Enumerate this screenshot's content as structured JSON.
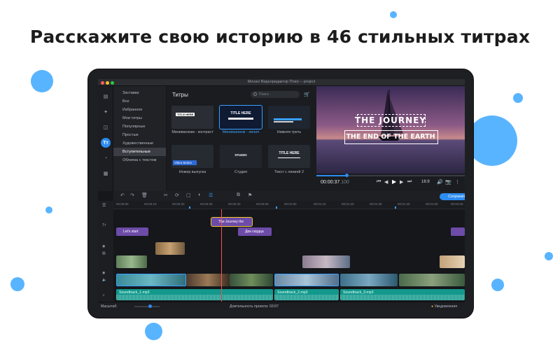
{
  "headline": "Расскажите свою историю в 46 стильных титрах",
  "colors": {
    "accent_dots": "#59b4ff",
    "app_accent": "#2d8cf0",
    "title_clip": "#6d4ba8",
    "audio_clip": "#13988c",
    "playhead": "#ff4f4f"
  },
  "app": {
    "window_title": "Movavi Видеоредактор Плюс – project"
  },
  "sidebar_icons": [
    "import-icon",
    "effects-icon",
    "transitions-icon",
    "titles-icon",
    "stickers-icon",
    "more-icon"
  ],
  "categories": [
    {
      "label": "Заставки",
      "active": false
    },
    {
      "label": "Все",
      "active": false
    },
    {
      "label": "Избранное",
      "active": false
    },
    {
      "label": "Мои титры",
      "active": false
    },
    {
      "label": "Популярные",
      "active": false
    },
    {
      "label": "Простые",
      "active": false
    },
    {
      "label": "Художественные",
      "active": false
    },
    {
      "label": "Вступительные",
      "active": true
    },
    {
      "label": "Облачка с текстом",
      "active": false
    }
  ],
  "gallery": {
    "title": "Титры",
    "search_placeholder": "Поиск",
    "items": [
      {
        "label": "Минимализм - контраст",
        "thumb_text": "TITLE HERE",
        "selected": false
      },
      {
        "label": "Минимализм - линия",
        "thumb_text": "TITLE HERE",
        "selected": true
      },
      {
        "label": "Нижняя треть",
        "thumb_text": "",
        "selected": false
      },
      {
        "label": "Номер выпуска",
        "thumb_text": "Video Series",
        "selected": false
      },
      {
        "label": "Студия",
        "thumb_text": "STUDIO",
        "selected": false
      },
      {
        "label": "Текст с линией 2",
        "thumb_text": "TITLE HERE",
        "selected": false
      }
    ]
  },
  "preview": {
    "title_line1": "THE JOURNEY",
    "title_line2": "THE END OF THE EARTH",
    "time": "00:00:37",
    "time_ms": ".100",
    "aspect": "16:9",
    "progress": 0.2
  },
  "toolbar": {
    "save_label": "Сохранить"
  },
  "ruler": {
    "marks": [
      "00:00:00",
      "00:00:10",
      "00:00:20",
      "00:00:30",
      "00:00:40",
      "00:00:50",
      "00:01:00",
      "00:01:10",
      "00:01:20",
      "00:01:30",
      "00:01:40",
      "00:01:50",
      "00:02:00"
    ]
  },
  "timeline": {
    "title_clips": [
      {
        "label": "Let's start",
        "selected": false
      },
      {
        "label": "The Journey the",
        "selected": true
      },
      {
        "label": "Два сердца",
        "selected": false
      }
    ],
    "audio_clips": [
      {
        "label": "Soundtrack_1.mp3"
      },
      {
        "label": "Soundtrack_2.mp3"
      },
      {
        "label": "Soundtrack_3.mp3"
      }
    ]
  },
  "status": {
    "scale_label": "Масштаб:",
    "duration": "Длительность проекта:  03:07",
    "notifications": "Уведомления"
  }
}
